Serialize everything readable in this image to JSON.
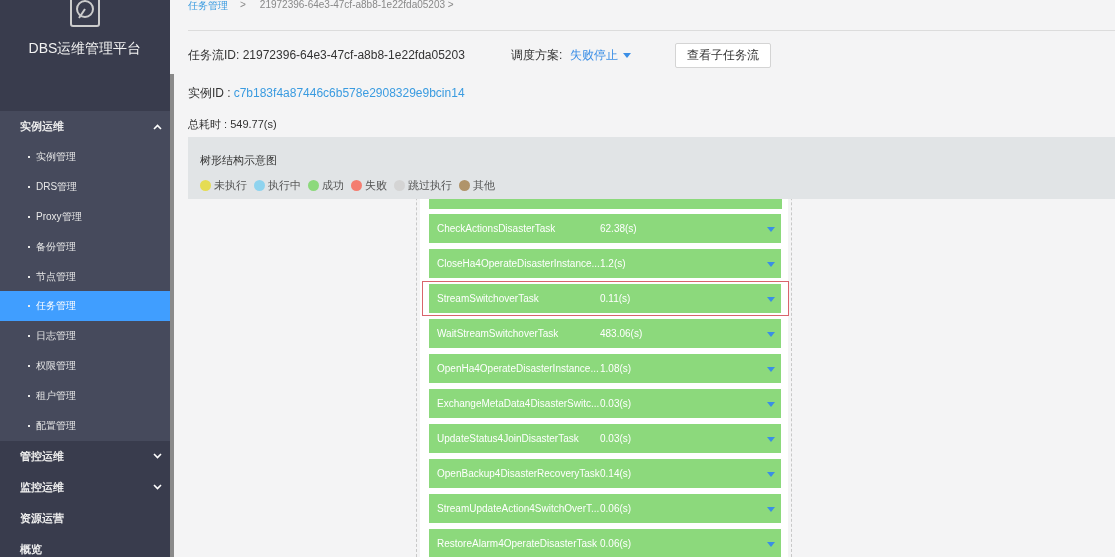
{
  "sidebar": {
    "title": "DBS运维管理平台",
    "groups": [
      {
        "label": "实例运维",
        "expanded": true,
        "items": [
          {
            "label": "实例管理",
            "selected": false
          },
          {
            "label": "DRS管理",
            "selected": false
          },
          {
            "label": "Proxy管理",
            "selected": false
          },
          {
            "label": "备份管理",
            "selected": false
          },
          {
            "label": "节点管理",
            "selected": false
          },
          {
            "label": "任务管理",
            "selected": true
          },
          {
            "label": "日志管理",
            "selected": false
          },
          {
            "label": "权限管理",
            "selected": false
          },
          {
            "label": "租户管理",
            "selected": false
          },
          {
            "label": "配置管理",
            "selected": false
          }
        ]
      },
      {
        "label": "管控运维",
        "expanded": false
      },
      {
        "label": "监控运维",
        "expanded": false
      },
      {
        "label": "资源运营"
      },
      {
        "label": "概览"
      }
    ]
  },
  "breadcrumb": [
    {
      "label": "任务管理",
      "kind": "link"
    },
    {
      "label": ">",
      "kind": "separator"
    },
    {
      "label": "21972396-64e3-47cf-a8b8-1e22fda05203 >",
      "kind": "current"
    }
  ],
  "task_flow": {
    "id_label": "任务流ID:",
    "id": "21972396-64e3-47cf-a8b8-1e22fda05203",
    "schedule_label": "调度方案:",
    "schedule_value": "失败停止",
    "button": "查看子任务流"
  },
  "instance": {
    "label": "实例ID :",
    "id": "c7b183f4a87446c6b578e2908329e9bcin14"
  },
  "total_time": "总耗时 : 549.77(s)",
  "tree_panel": {
    "title": "树形结构示意图",
    "legend": [
      {
        "label": "未执行",
        "color": "#e5dc53"
      },
      {
        "label": "执行中",
        "color": "#8ed3ee"
      },
      {
        "label": "成功",
        "color": "#8cd97c"
      },
      {
        "label": "失败",
        "color": "#f47d70"
      },
      {
        "label": "跳过执行",
        "color": "#d4d4d4"
      },
      {
        "label": "其他",
        "color": "#b0946a"
      }
    ]
  },
  "tasks": [
    {
      "name": "CheckActionsDisasterTask",
      "time": "62.38(s)",
      "color": "#8cd97c",
      "selected": false
    },
    {
      "name": "CloseHa4OperateDisasterInstance...",
      "time": "1.2(s)",
      "color": "#8cd97c",
      "selected": false
    },
    {
      "name": "StreamSwitchoverTask",
      "time": "0.11(s)",
      "color": "#8cd97c",
      "selected": true
    },
    {
      "name": "WaitStreamSwitchoverTask",
      "time": "483.06(s)",
      "color": "#8cd97c",
      "selected": false
    },
    {
      "name": "OpenHa4OperateDisasterInstance...",
      "time": "1.08(s)",
      "color": "#8cd97c",
      "selected": false
    },
    {
      "name": "ExchangeMetaData4DisasterSwitc...",
      "time": "0.03(s)",
      "color": "#8cd97c",
      "selected": false
    },
    {
      "name": "UpdateStatus4JoinDisasterTask",
      "time": "0.03(s)",
      "color": "#8cd97c",
      "selected": false
    },
    {
      "name": "OpenBackup4DisasterRecoveryTask",
      "time": "0.14(s)",
      "color": "#8cd97c",
      "selected": false
    },
    {
      "name": "StreamUpdateAction4SwitchOverT...",
      "time": "0.06(s)",
      "color": "#8cd97c",
      "selected": false
    },
    {
      "name": "RestoreAlarm4OperateDisasterTask",
      "time": "0.06(s)",
      "color": "#8cd97c",
      "selected": false
    }
  ]
}
